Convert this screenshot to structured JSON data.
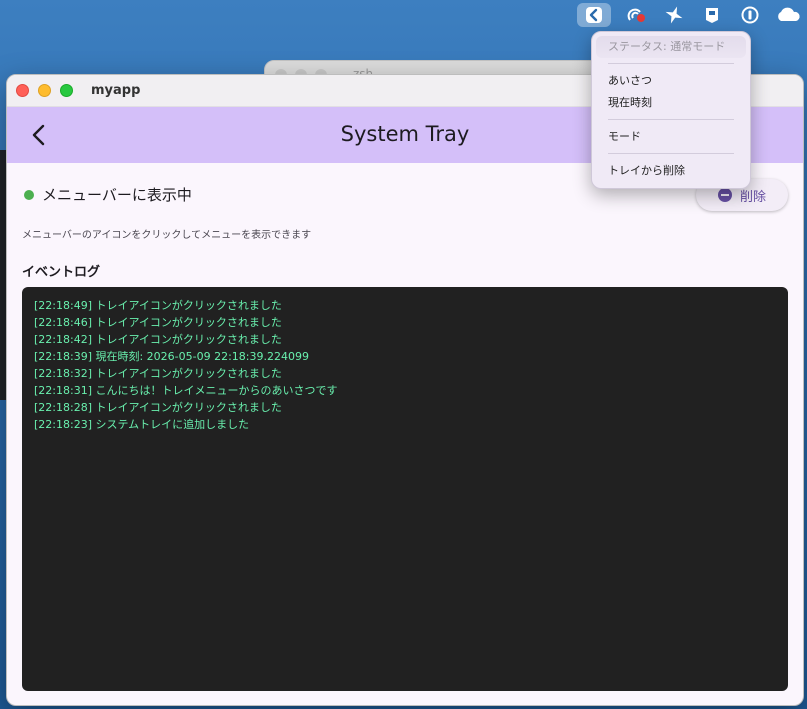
{
  "menubar": {
    "icons": [
      "flutter-app-icon",
      "creative-cloud-icon",
      "airplane-icon",
      "box-icon",
      "onepassword-icon",
      "cloud-icon"
    ],
    "notification_color": "#e53935"
  },
  "background_window": {
    "title": "zsh"
  },
  "window": {
    "title": "myapp"
  },
  "appbar": {
    "title": "System Tray",
    "color": "#d4bff9"
  },
  "status": {
    "label": "メニューバーに表示中",
    "dot_color": "#4caf50",
    "delete_label": "削除",
    "hint": "メニューバーのアイコンをクリックしてメニューを表示できます"
  },
  "log": {
    "title": "イベントログ",
    "text_color": "#69f0ae",
    "lines": [
      "[22:18:49] トレイアイコンがクリックされました",
      "[22:18:46] トレイアイコンがクリックされました",
      "[22:18:42] トレイアイコンがクリックされました",
      "[22:18:39] 現在時刻: 2026-05-09 22:18:39.224099",
      "[22:18:32] トレイアイコンがクリックされました",
      "[22:18:31] こんにちは！トレイメニューからのあいさつです",
      "[22:18:28] トレイアイコンがクリックされました",
      "[22:18:23] システムトレイに追加しました"
    ]
  },
  "tray_menu": {
    "status": "ステータス: 通常モード",
    "items": [
      "あいさつ",
      "現在時刻"
    ],
    "mode": "モード",
    "remove": "トレイから削除"
  }
}
